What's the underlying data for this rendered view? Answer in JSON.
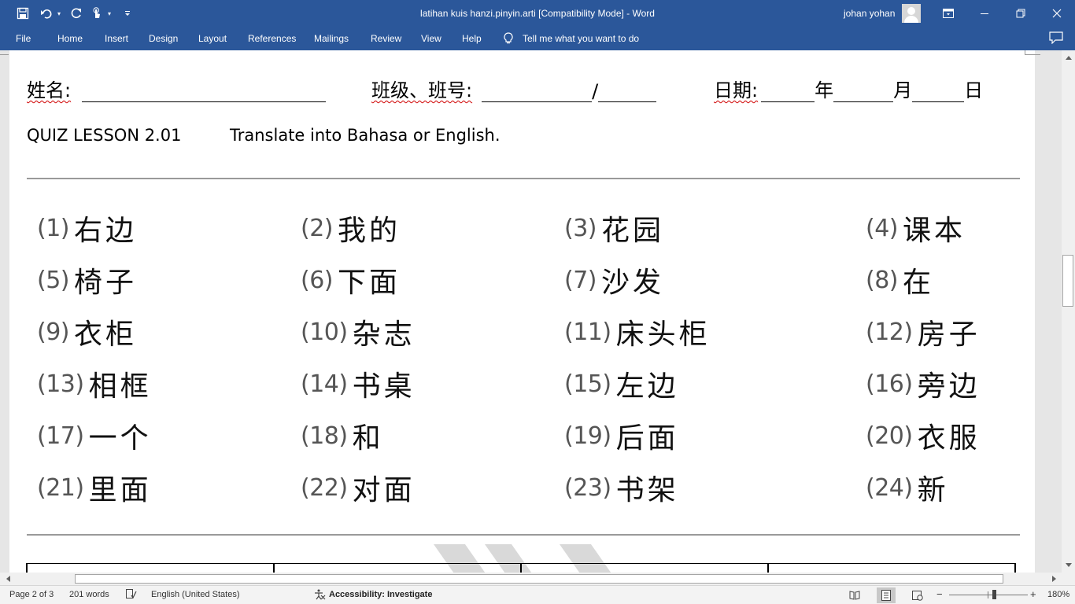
{
  "titlebar": {
    "doc_title": "latihan kuis hanzi.pinyin.arti [Compatibility Mode]  -  Word",
    "user_name": "johan yohan"
  },
  "colors": {
    "accent": "#2b579a",
    "misspell": "#d00000"
  },
  "icons": [
    "save-icon",
    "undo-icon",
    "redo-icon",
    "touch-mode-icon",
    "customize-icon",
    "ribbon-display-icon",
    "minimize-icon",
    "restore-icon",
    "close-icon",
    "lightbulb-icon",
    "comment-icon"
  ],
  "ribbon": {
    "tabs": [
      "File",
      "Home",
      "Insert",
      "Design",
      "Layout",
      "References",
      "Mailings",
      "Review",
      "View",
      "Help"
    ],
    "tell_me": "Tell me what you want to do"
  },
  "document": {
    "header": {
      "name_label": "姓名:",
      "class_label": "班级、班号:",
      "class_sep": "/",
      "date_label": "日期:",
      "year": "年",
      "month": "月",
      "day": "日"
    },
    "quiz_title": "QUIZ LESSON 2.01",
    "instruction": "Translate into Bahasa or English.",
    "items": [
      {
        "num": "(1)",
        "text": "右边"
      },
      {
        "num": "(2)",
        "text": "我的"
      },
      {
        "num": "(3)",
        "text": "花园"
      },
      {
        "num": "(4)",
        "text": "课本"
      },
      {
        "num": "(5)",
        "text": "椅子"
      },
      {
        "num": "(6)",
        "text": "下面"
      },
      {
        "num": "(7)",
        "text": "沙发"
      },
      {
        "num": "(8)",
        "text": "在"
      },
      {
        "num": "(9)",
        "text": "衣柜"
      },
      {
        "num": "(10)",
        "text": "杂志"
      },
      {
        "num": "(11)",
        "text": "床头柜"
      },
      {
        "num": "(12)",
        "text": "房子"
      },
      {
        "num": "(13)",
        "text": "相框"
      },
      {
        "num": "(14)",
        "text": "书桌"
      },
      {
        "num": "(15)",
        "text": "左边"
      },
      {
        "num": "(16)",
        "text": "旁边"
      },
      {
        "num": "(17)",
        "text": "一个"
      },
      {
        "num": "(18)",
        "text": "和"
      },
      {
        "num": "(19)",
        "text": "后面"
      },
      {
        "num": "(20)",
        "text": "衣服"
      },
      {
        "num": "(21)",
        "text": "里面"
      },
      {
        "num": "(22)",
        "text": "对面"
      },
      {
        "num": "(23)",
        "text": "书架"
      },
      {
        "num": "(24)",
        "text": "新"
      }
    ]
  },
  "status": {
    "page": "Page 2 of 3",
    "words": "201 words",
    "language": "English (United States)",
    "accessibility": "Accessibility: Investigate",
    "zoom": "180%"
  }
}
